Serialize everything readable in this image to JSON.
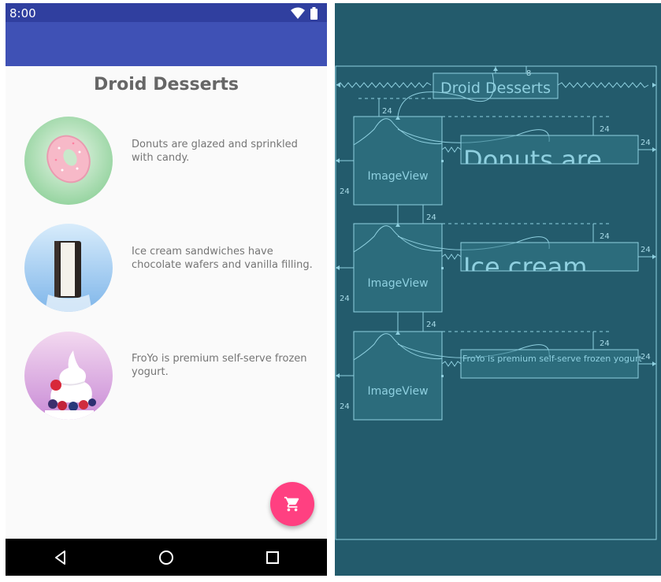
{
  "status_bar": {
    "time": "8:00"
  },
  "app": {
    "title": "Droid Desserts"
  },
  "desserts": [
    {
      "name": "donut",
      "description": "Donuts are glazed and sprinkled with candy."
    },
    {
      "name": "ice-cream-sandwich",
      "description": "Ice cream sandwiches have chocolate wafers and vanilla filling."
    },
    {
      "name": "froyo",
      "description": "FroYo is premium self-serve frozen yogurt."
    }
  ],
  "fab": {
    "icon": "shopping-cart-icon"
  },
  "nav_bar": {
    "back_icon": "back-icon",
    "home_icon": "home-icon",
    "recents_icon": "recents-icon"
  },
  "blueprint": {
    "title": "Droid Desserts",
    "imageview_label": "ImageView",
    "row_texts": [
      "Donuts are",
      "Ice cream",
      "FroYo is premium self-serve frozen yogurt"
    ],
    "margin_24": "24",
    "margin_8": "8"
  },
  "colors": {
    "status_bar": "#303f9f",
    "app_bar": "#3f51b5",
    "fab": "#ff4081",
    "blueprint_bg": "#235b6c",
    "blueprint_line": "#8fd0e0"
  }
}
